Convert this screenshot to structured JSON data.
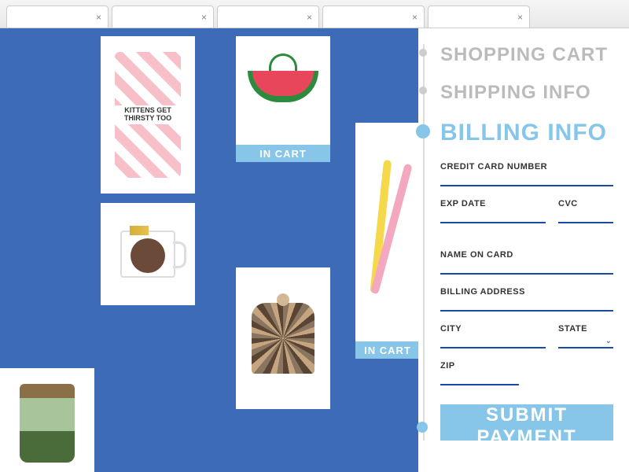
{
  "steps": {
    "cart": "SHOPPING CART",
    "shipping": "SHIPPING INFO",
    "billing": "BILLING INFO"
  },
  "form": {
    "card_number_label": "CREDIT CARD NUMBER",
    "exp_label": "EXP DATE",
    "cvc_label": "CVC",
    "name_label": "NAME ON CARD",
    "address_label": "BILLING ADDRESS",
    "city_label": "CITY",
    "state_label": "STATE",
    "zip_label": "ZIP"
  },
  "badges": {
    "in_cart": "IN CART"
  },
  "submit_label": "SUBMIT PAYMENT",
  "products": {
    "cup_text": "KITTENS GET THIRSTY TOO"
  }
}
